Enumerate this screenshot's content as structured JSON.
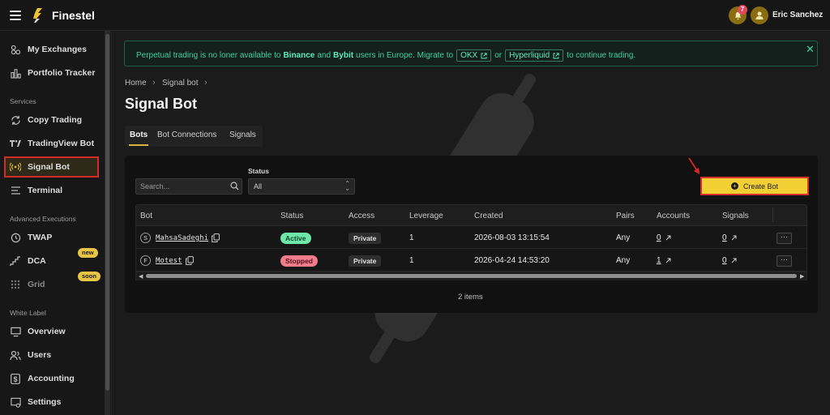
{
  "app": {
    "brand": "Finestel",
    "username": "Eric Sanchez",
    "notifications": "7"
  },
  "sidebar": {
    "items": [
      {
        "label": "My Exchanges",
        "icon": "exchanges-icon"
      },
      {
        "label": "Portfolio Tracker",
        "icon": "portfolio-icon"
      },
      {
        "label": "Copy Trading",
        "icon": "copy-trading-icon"
      },
      {
        "label": "TradingView Bot",
        "icon": "tradingview-icon"
      },
      {
        "label": "Signal Bot",
        "icon": "signal-icon"
      },
      {
        "label": "Terminal",
        "icon": "terminal-icon"
      },
      {
        "label": "TWAP",
        "icon": "clock-icon"
      },
      {
        "label": "DCA",
        "icon": "dca-icon"
      },
      {
        "label": "Grid",
        "icon": "grid-icon"
      },
      {
        "label": "Overview",
        "icon": "overview-icon"
      },
      {
        "label": "Users",
        "icon": "users-icon"
      },
      {
        "label": "Accounting",
        "icon": "dollar-icon"
      },
      {
        "label": "Settings",
        "icon": "settings-icon"
      }
    ],
    "sections": {
      "services": "Services",
      "advanced": "Advanced Executions",
      "white_label": "White Label"
    },
    "tags": {
      "new": "new",
      "soon": "soon"
    }
  },
  "notice": {
    "text_start": "Perpetual trading is no loner available to",
    "exchange_1": "Binance",
    "and": "and",
    "exchange_2": "Bybit",
    "text_mid": "users in Europe. Migrate to",
    "link_1": "OKX",
    "or": "or",
    "link_2": "Hyperliquid",
    "text_end": "to continue trading."
  },
  "breadcrumb": {
    "home": "Home",
    "current": "Signal bot"
  },
  "page": {
    "title": "Signal Bot"
  },
  "tabs": [
    "Bots",
    "Bot Connections",
    "Signals"
  ],
  "filters": {
    "search_placeholder": "Search...",
    "status_label": "Status",
    "status_value": "All"
  },
  "create_button": "Create Bot",
  "table": {
    "columns": [
      "Bot",
      "Status",
      "Access",
      "Leverage",
      "Created",
      "Pairs",
      "Accounts",
      "Signals"
    ],
    "rows": [
      {
        "initial": "S",
        "name": "MahsaSadeghi",
        "status": "Active",
        "access": "Private",
        "leverage": "1",
        "created": "2026-08-03 13:15:54",
        "pairs": "Any",
        "accounts": "0",
        "signals": "0"
      },
      {
        "initial": "F",
        "name": "Motest",
        "status": "Stopped",
        "access": "Private",
        "leverage": "1",
        "created": "2026-04-24 14:53:20",
        "pairs": "Any",
        "accounts": "1",
        "signals": "0"
      }
    ],
    "more": "···",
    "items_count": "2 items"
  }
}
